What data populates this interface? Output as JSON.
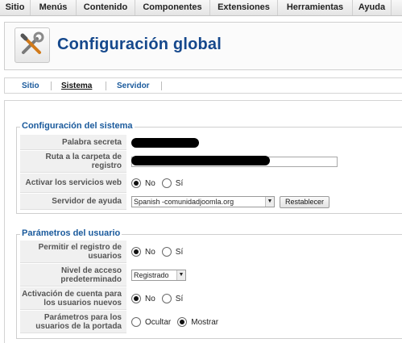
{
  "menu": [
    "Sitio",
    "Menús",
    "Contenido",
    "Componentes",
    "Extensiones",
    "Herramientas",
    "Ayuda"
  ],
  "header": {
    "title": "Configuración global",
    "logo_icon": "tools-config-icon"
  },
  "tabs": [
    {
      "label": "Sitio",
      "active": false
    },
    {
      "label": "Sistema",
      "active": true
    },
    {
      "label": "Servidor",
      "active": false
    }
  ],
  "system_config": {
    "legend": "Configuración del sistema",
    "secret_word_label": "Palabra secreta",
    "log_path_label": "Ruta a la carpeta de registro",
    "web_services_label": "Activar los servicios web",
    "web_services_options": [
      "No",
      "Sí"
    ],
    "web_services_selected": "No",
    "help_server_label": "Servidor de ayuda",
    "help_server_value": "Spanish -comunidadjoomla.org",
    "reset_button": "Restablecer"
  },
  "user_params": {
    "legend": "Parámetros del usuario",
    "allow_registration_label": "Permitir el registro de usuarios",
    "allow_registration_options": [
      "No",
      "Sí"
    ],
    "allow_registration_selected": "No",
    "access_level_label": "Nivel de acceso predeterminado",
    "access_level_value": "Registrado",
    "activation_label": "Activación de cuenta para los usuarios nuevos",
    "activation_options": [
      "No",
      "Sí"
    ],
    "activation_selected": "No",
    "frontend_params_label": "Parámetros para los usuarios de la portada",
    "frontend_params_options": [
      "Ocultar",
      "Mostrar"
    ],
    "frontend_params_selected": "Mostrar"
  },
  "colors": {
    "accent": "#15488c",
    "link": "#1a5a9c",
    "label_bg": "#f0f0f0"
  }
}
